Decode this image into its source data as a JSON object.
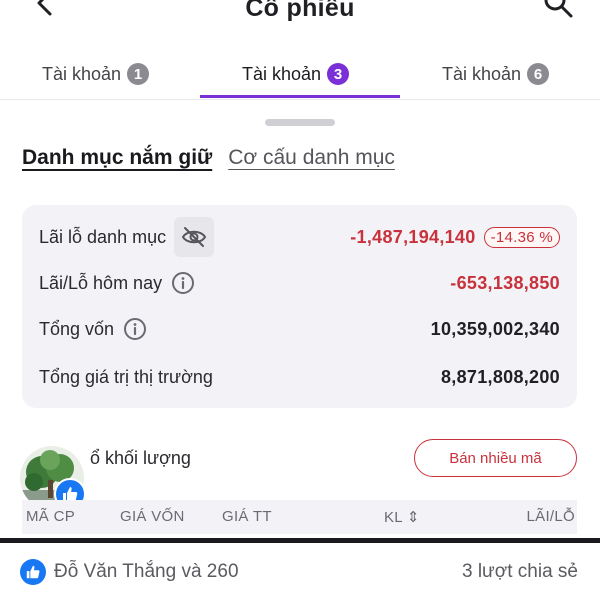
{
  "header": {
    "title": "Cổ phiếu",
    "back_icon": "chevron-left-icon",
    "search_icon": "search-icon"
  },
  "tabs": [
    {
      "label": "Tài khoản",
      "count": "1",
      "active": false
    },
    {
      "label": "Tài khoản",
      "count": "3",
      "active": true
    },
    {
      "label": "Tài khoản",
      "count": "6",
      "active": false
    }
  ],
  "section_tabs": {
    "holdings": "Danh mục nắm giữ",
    "structure": "Cơ cấu danh mục"
  },
  "summary": {
    "portfolio_pl_label": "Lãi lỗ danh mục",
    "portfolio_pl_value": "-1,487,194,140",
    "portfolio_pl_pct": "-14.36 %",
    "today_pl_label": "Lãi/Lỗ hôm nay",
    "today_pl_value": "-653,138,850",
    "capital_label": "Tổng vốn",
    "capital_value": "10,359,002,340",
    "market_value_label": "Tổng giá trị thị trường",
    "market_value_value": "8,871,808,200"
  },
  "volume": {
    "label": "ổ khối lượng",
    "sell_many_label": "Bán nhiều mã"
  },
  "table": {
    "columns": [
      "MÃ CP",
      "GIÁ VỐN",
      "GIÁ TT",
      "KL ⇕",
      "LÃI/LỖ"
    ]
  },
  "social": {
    "reactors": "Đỗ Văn Thắng và 260",
    "shares": "3 lượt chia sẻ"
  },
  "colors": {
    "accent": "#7b2fd6",
    "negative": "#c8323c",
    "facebook_blue": "#1877f2"
  }
}
